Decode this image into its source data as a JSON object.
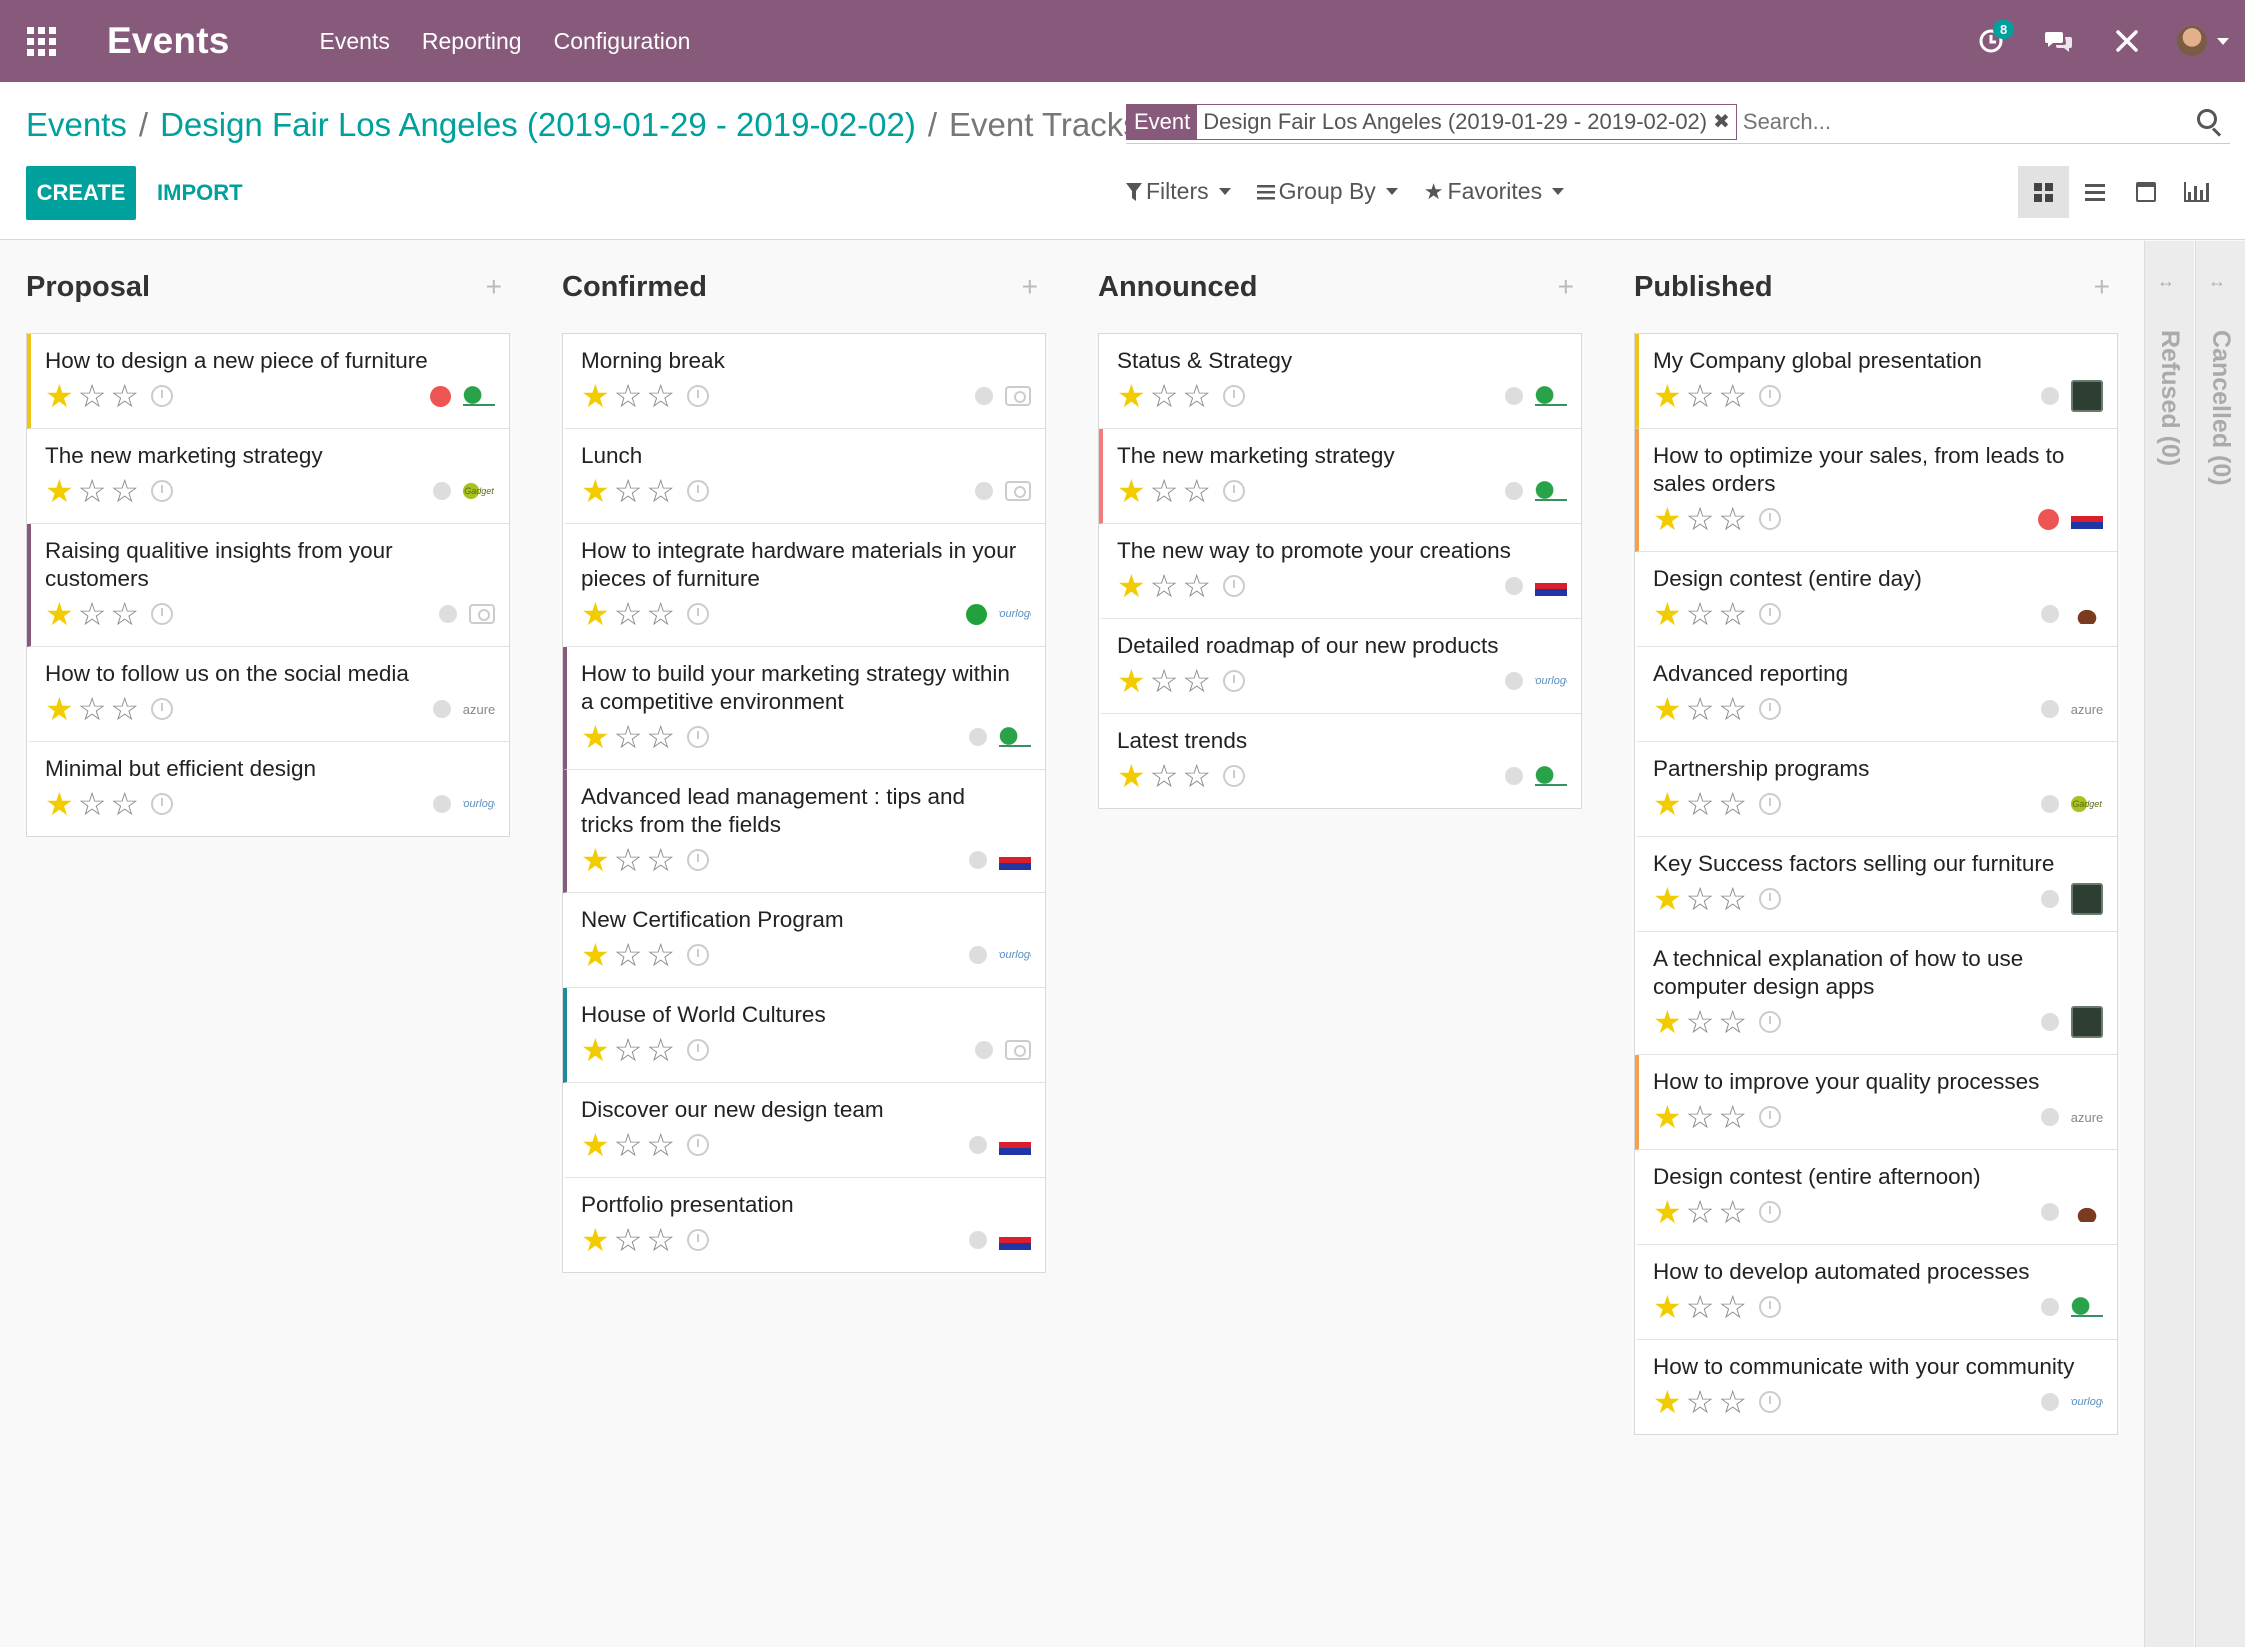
{
  "navbar": {
    "app_name": "Events",
    "menu": [
      "Events",
      "Reporting",
      "Configuration"
    ],
    "activity_count": "8",
    "icons": [
      "apps-icon",
      "activity-clock-icon",
      "chat-icon",
      "debug-tools-icon",
      "user-avatar"
    ],
    "color": "#875a7b"
  },
  "breadcrumb": {
    "root": "Events",
    "parent": "Design Fair Los Angeles (2019-01-29 - 2019-02-02)",
    "current": "Event Tracks",
    "separator": "/"
  },
  "buttons": {
    "create": "CREATE",
    "import": "IMPORT"
  },
  "search": {
    "facet_category": "Event",
    "facet_value": "Design Fair Los Angeles (2019-01-29 - 2019-02-02)",
    "facet_close": "✖",
    "placeholder": "Search..."
  },
  "filters": {
    "filters": "Filters",
    "group_by": "Group By",
    "favorites": "Favorites"
  },
  "views": [
    "kanban",
    "list",
    "calendar",
    "graph"
  ],
  "accent_color": "#00a09d",
  "columns": [
    {
      "title": "Proposal",
      "cards": [
        {
          "title": "How to design a new piece of furniture",
          "stars": 1,
          "state": "red",
          "logo": "green-badge",
          "accent": "#f0c419"
        },
        {
          "title": "The new marketing strategy",
          "stars": 1,
          "state": "grey",
          "logo": "yellowg",
          "accent": ""
        },
        {
          "title": "Raising qualitive insights from your customers",
          "stars": 1,
          "state": "grey",
          "logo": "camera",
          "accent": "#875a7b"
        },
        {
          "title": "How to follow us on the social media",
          "stars": 1,
          "state": "grey",
          "logo": "azure",
          "accent": ""
        },
        {
          "title": "Minimal but efficient design",
          "stars": 1,
          "state": "grey",
          "logo": "script",
          "accent": ""
        }
      ]
    },
    {
      "title": "Confirmed",
      "cards": [
        {
          "title": "Morning break",
          "stars": 1,
          "state": "grey",
          "logo": "camera",
          "accent": ""
        },
        {
          "title": "Lunch",
          "stars": 1,
          "state": "grey",
          "logo": "camera",
          "accent": ""
        },
        {
          "title": "How to integrate hardware materials in your pieces of furniture",
          "stars": 1,
          "state": "green",
          "logo": "script",
          "accent": ""
        },
        {
          "title": "How to build your marketing strategy within a competitive environment",
          "stars": 1,
          "state": "grey",
          "logo": "green-badge",
          "accent": "#875a7b"
        },
        {
          "title": "Advanced lead management : tips and tricks from the fields",
          "stars": 1,
          "state": "grey",
          "logo": "ready",
          "accent": "#875a7b"
        },
        {
          "title": "New Certification Program",
          "stars": 1,
          "state": "grey",
          "logo": "script",
          "accent": ""
        },
        {
          "title": "House of World Cultures",
          "stars": 1,
          "state": "grey",
          "logo": "camera",
          "accent": "#1f8a9c"
        },
        {
          "title": "Discover our new design team",
          "stars": 1,
          "state": "grey",
          "logo": "ready",
          "accent": ""
        },
        {
          "title": "Portfolio presentation",
          "stars": 1,
          "state": "grey",
          "logo": "ready",
          "accent": ""
        }
      ]
    },
    {
      "title": "Announced",
      "cards": [
        {
          "title": "Status & Strategy",
          "stars": 1,
          "state": "grey",
          "logo": "green-badge",
          "accent": ""
        },
        {
          "title": "The new marketing strategy",
          "stars": 1,
          "state": "grey",
          "logo": "green-badge",
          "accent": "#f27c7c"
        },
        {
          "title": "The new way to promote your creations",
          "stars": 1,
          "state": "grey",
          "logo": "ready",
          "accent": ""
        },
        {
          "title": "Detailed roadmap of our new products",
          "stars": 1,
          "state": "grey",
          "logo": "script",
          "accent": ""
        },
        {
          "title": "Latest trends",
          "stars": 1,
          "state": "grey",
          "logo": "green-badge",
          "accent": ""
        }
      ]
    },
    {
      "title": "Published",
      "cards": [
        {
          "title": "My Company global presentation",
          "stars": 1,
          "state": "grey",
          "logo": "wood",
          "accent": "#f0c419"
        },
        {
          "title": "How to optimize your sales, from leads to sales orders",
          "stars": 1,
          "state": "red",
          "logo": "ready",
          "accent": "#f5a14b"
        },
        {
          "title": "Design contest (entire day)",
          "stars": 1,
          "state": "grey",
          "logo": "lumber",
          "accent": ""
        },
        {
          "title": "Advanced reporting",
          "stars": 1,
          "state": "grey",
          "logo": "azure",
          "accent": ""
        },
        {
          "title": "Partnership programs",
          "stars": 1,
          "state": "grey",
          "logo": "yellowg",
          "accent": ""
        },
        {
          "title": "Key Success factors selling our furniture",
          "stars": 1,
          "state": "grey",
          "logo": "wood",
          "accent": ""
        },
        {
          "title": "A technical explanation of how to use computer design apps",
          "stars": 1,
          "state": "grey",
          "logo": "wood",
          "accent": ""
        },
        {
          "title": "How to improve your quality processes",
          "stars": 1,
          "state": "grey",
          "logo": "azure",
          "accent": "#f5a14b"
        },
        {
          "title": "Design contest (entire afternoon)",
          "stars": 1,
          "state": "grey",
          "logo": "lumber",
          "accent": ""
        },
        {
          "title": "How to develop automated processes",
          "stars": 1,
          "state": "grey",
          "logo": "green-badge",
          "accent": ""
        },
        {
          "title": "How to communicate with your community",
          "stars": 1,
          "state": "grey",
          "logo": "script",
          "accent": ""
        }
      ]
    }
  ],
  "folded_columns": [
    "Refused (0)",
    "Cancelled (0)"
  ],
  "star_glyphs": {
    "on": "★",
    "off": "☆"
  },
  "logo_text": {
    "azure": "azure",
    "script": "yourlogo",
    "yellowg": "Gadget"
  }
}
